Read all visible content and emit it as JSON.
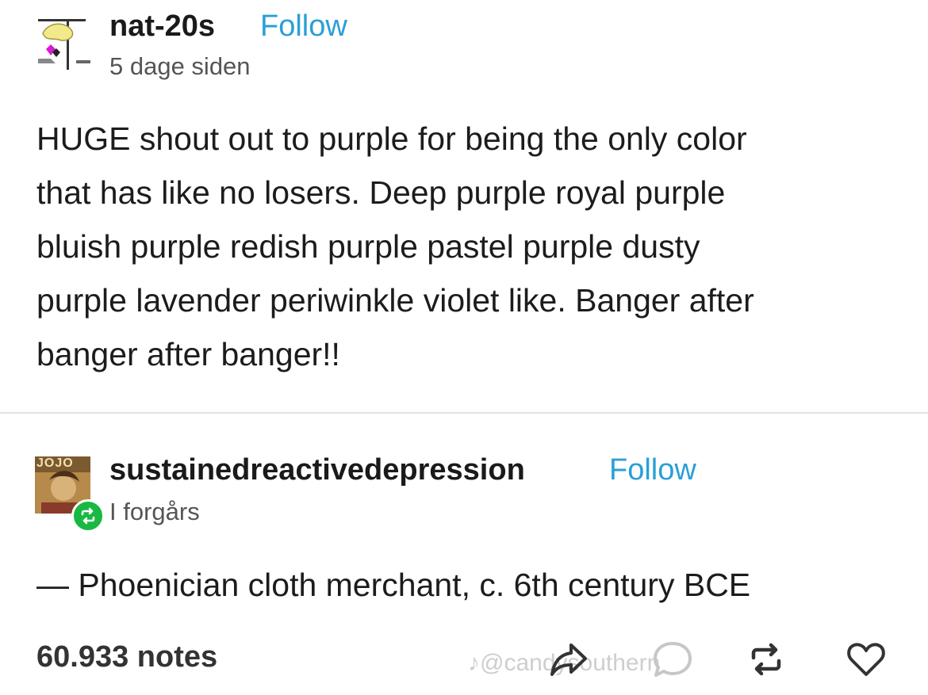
{
  "post1": {
    "username": "nat-20s",
    "follow_label": "Follow",
    "timestamp": "5 dage siden",
    "lines": [
      "HUGE shout out to purple for being the only color",
      "that has like no losers. Deep purple royal purple",
      "bluish purple redish purple pastel purple dusty",
      "purple lavender periwinkle violet like. Banger after",
      "banger after banger!!"
    ]
  },
  "post2": {
    "username": "sustainedreactivedepression",
    "follow_label": "Follow",
    "timestamp": "I forgårs",
    "text": "— Phoenician cloth merchant, c. 6th century BCE",
    "avatar_text": "JOJO"
  },
  "footer": {
    "notes": "60.933 notes",
    "icons": [
      "share-icon",
      "comment-icon",
      "reblog-icon",
      "heart-icon"
    ]
  },
  "watermark": "♪@candysouthern",
  "colors": {
    "follow": "#2a9fd6",
    "reblog_badge": "#19b843",
    "text": "#1a1a1a"
  }
}
